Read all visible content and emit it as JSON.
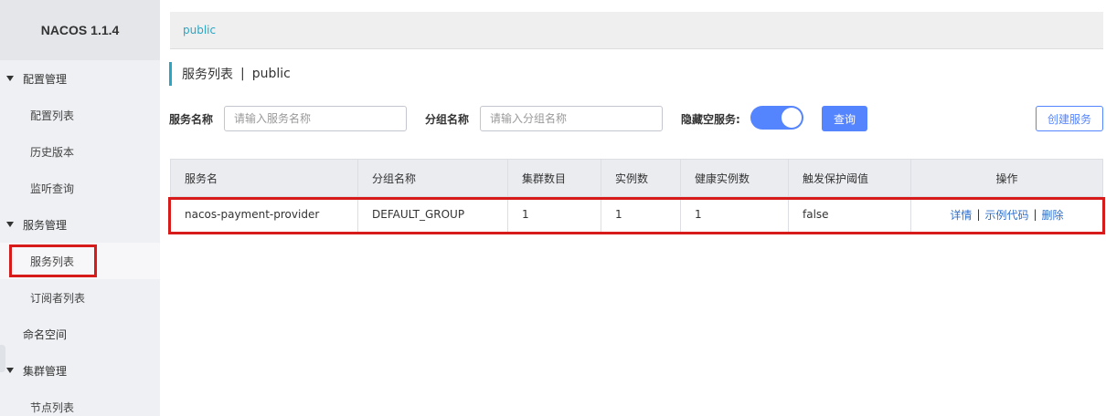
{
  "brand": "NACOS 1.1.4",
  "sidebar": {
    "config_group": "配置管理",
    "config_list": "配置列表",
    "history": "历史版本",
    "listen_query": "监听查询",
    "service_group": "服务管理",
    "service_list": "服务列表",
    "subscriber_list": "订阅者列表",
    "namespace": "命名空间",
    "cluster_group": "集群管理",
    "node_list": "节点列表"
  },
  "breadcrumb": "public",
  "page_title": {
    "main": "服务列表",
    "sep": "|",
    "namespace": "public"
  },
  "filters": {
    "service_name_label": "服务名称",
    "service_name_placeholder": "请输入服务名称",
    "group_name_label": "分组名称",
    "group_name_placeholder": "请输入分组名称",
    "hide_empty_label": "隐藏空服务:",
    "hide_empty_on": true,
    "query_label": "查询",
    "create_label": "创建服务"
  },
  "table": {
    "headers": [
      "服务名",
      "分组名称",
      "集群数目",
      "实例数",
      "健康实例数",
      "触发保护阈值",
      "操作"
    ],
    "rows": [
      {
        "service_name": "nacos-payment-provider",
        "group": "DEFAULT_GROUP",
        "clusters": "1",
        "instances": "1",
        "healthy": "1",
        "threshold": "false",
        "ops": {
          "detail": "详情",
          "sample_code": "示例代码",
          "delete": "删除",
          "sep": "|"
        }
      }
    ]
  },
  "colors": {
    "accent": "#5584ff",
    "teal": "#29a6c4",
    "highlight": "#d71a1a"
  }
}
